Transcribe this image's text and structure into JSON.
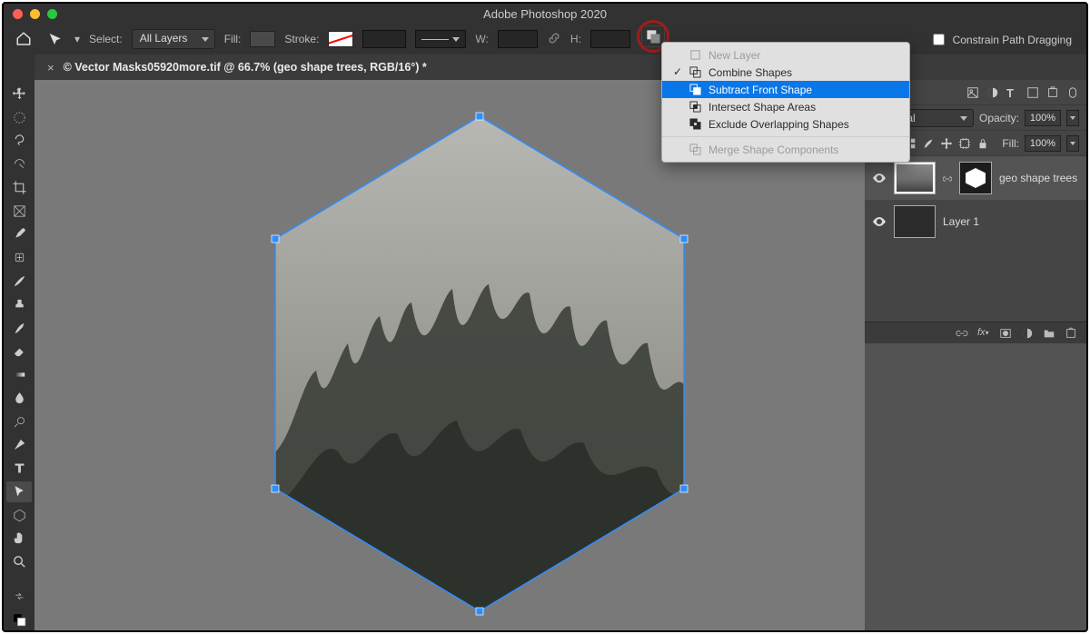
{
  "app_title": "Adobe Photoshop 2020",
  "tab": {
    "title": "© Vector Masks05920more.tif @ 66.7% (geo shape trees, RGB/16°) *"
  },
  "options": {
    "select_label": "Select:",
    "select_value": "All Layers",
    "fill_label": "Fill:",
    "stroke_label": "Stroke:",
    "w_label": "W:",
    "h_label": "H:",
    "constrain": "Constrain Path Dragging"
  },
  "path_operations": {
    "items": [
      {
        "label": "New Layer",
        "disabled": true,
        "checked": false
      },
      {
        "label": "Combine Shapes",
        "disabled": false,
        "checked": true
      },
      {
        "label": "Subtract Front Shape",
        "disabled": false,
        "highlight": true
      },
      {
        "label": "Intersect Shape Areas",
        "disabled": false
      },
      {
        "label": "Exclude Overlapping Shapes",
        "disabled": false
      }
    ],
    "merge": {
      "label": "Merge Shape Components",
      "disabled": true
    }
  },
  "layers_panel": {
    "blend_mode": "Normal",
    "opacity_label": "Opacity:",
    "opacity_value": "100%",
    "fill_label": "Fill:",
    "fill_value": "100%",
    "lock_label": "Lock:",
    "layers": [
      {
        "name": "geo shape trees",
        "has_mask": true
      },
      {
        "name": "Layer 1",
        "has_mask": false
      }
    ]
  }
}
